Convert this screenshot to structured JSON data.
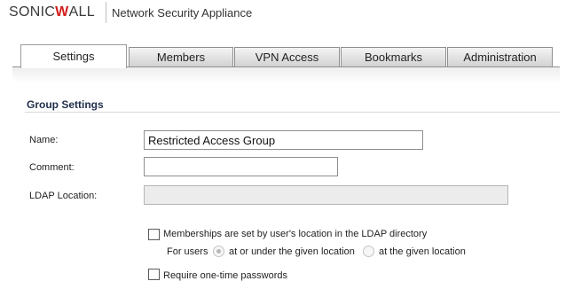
{
  "header": {
    "logo_prefix": "SONIC",
    "logo_mark": "W",
    "logo_suffix": "ALL",
    "product": "Network Security Appliance"
  },
  "tabs": [
    {
      "label": "Settings",
      "active": true
    },
    {
      "label": "Members",
      "active": false
    },
    {
      "label": "VPN Access",
      "active": false
    },
    {
      "label": "Bookmarks",
      "active": false
    },
    {
      "label": "Administration",
      "active": false
    }
  ],
  "section": {
    "title": "Group Settings"
  },
  "form": {
    "name_label": "Name:",
    "name_value": "Restricted Access Group",
    "comment_label": "Comment:",
    "comment_value": "",
    "ldap_label": "LDAP Location:",
    "ldap_value": "",
    "membership_checkbox_label": "Memberships are set by user's location in the LDAP directory",
    "membership_checked": false,
    "for_users_label": "For users",
    "radio_under_label": "at or under the given location",
    "radio_under_selected": true,
    "radio_at_label": "at the given location",
    "radio_at_selected": false,
    "otp_checkbox_label": "Require one-time passwords",
    "otp_checked": false
  }
}
